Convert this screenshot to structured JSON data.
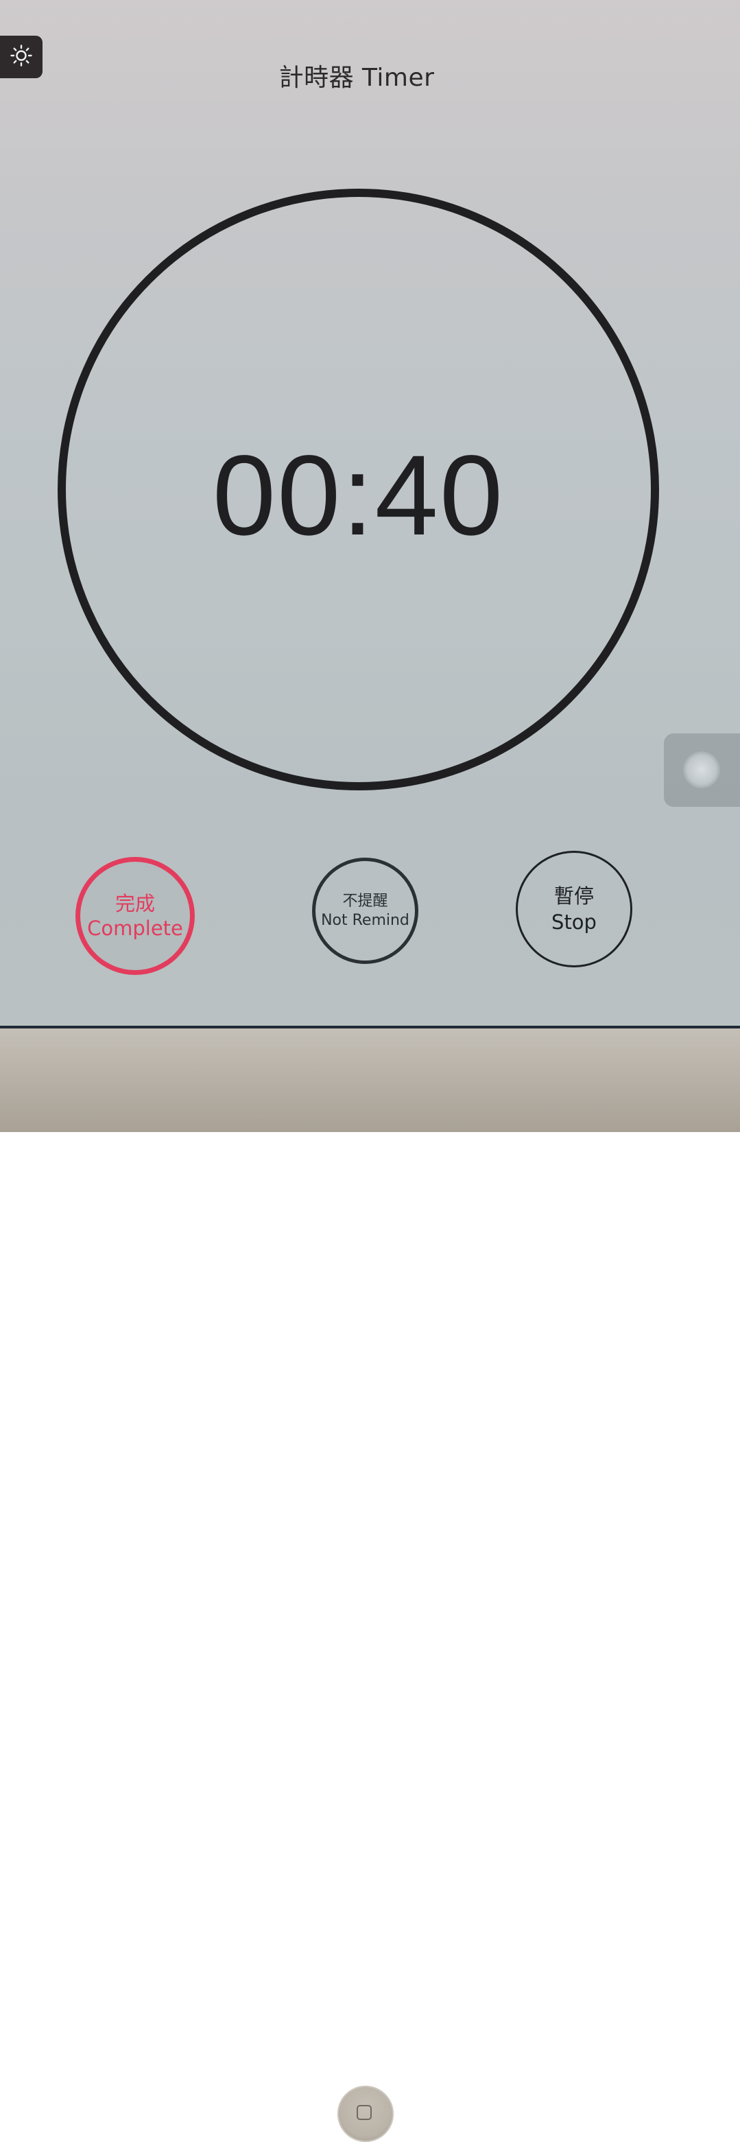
{
  "header": {
    "title": "計時器 Timer",
    "settings_icon": "brightness-icon"
  },
  "timer": {
    "display": "00:40"
  },
  "buttons": {
    "complete": {
      "cn": "完成",
      "en": "Complete",
      "color": "#e33c5d"
    },
    "not_remind": {
      "cn": "不提醒",
      "en": "Not Remind"
    },
    "stop": {
      "cn": "暫停",
      "en": "Stop"
    }
  },
  "overlay": {
    "assistive_touch_icon": "assistive-touch-icon"
  },
  "device": {
    "home_button_icon": "home-square-icon"
  }
}
